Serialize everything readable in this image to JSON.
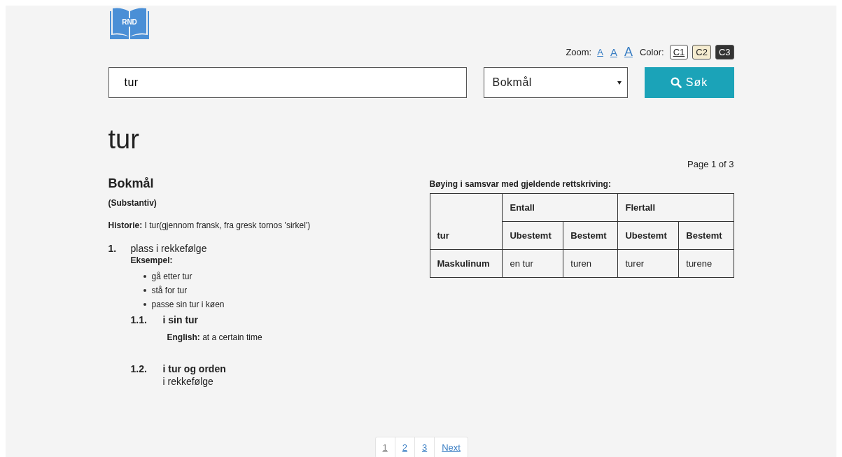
{
  "logo": {
    "text": "RND"
  },
  "zoom": {
    "label": "Zoom:",
    "sizes": [
      {
        "label": "A",
        "kind": "small"
      },
      {
        "label": "A",
        "kind": "medium"
      },
      {
        "label": "A",
        "kind": "large"
      }
    ]
  },
  "color": {
    "label": "Color:",
    "options": [
      {
        "label": "C1",
        "color": "#ffffff",
        "selected": true
      },
      {
        "label": "C2",
        "color": "#f5ecd0",
        "selected": false
      },
      {
        "label": "C3",
        "color": "#333333",
        "selected": false
      }
    ]
  },
  "search": {
    "value": "tur",
    "language": "Bokmål",
    "button": "Søk"
  },
  "headword": "tur",
  "page_info": "Page 1 of 3",
  "entry": {
    "language": "Bokmål",
    "word_class": "(Substantiv)",
    "history": "**Historie:** I tur(gjennom fransk, fra gresk tornos 'sirkel')",
    "senses": [
      {
        "number": "1.",
        "definition": "plass i rekkefølge",
        "examples_label": "Eksempel:",
        "examples": [
          "gå etter tur",
          "stå for tur",
          "passe sin tur i køen"
        ],
        "subsenses": [
          {
            "number": "1.1.",
            "phrase": "i sin tur",
            "gloss": "**English:** at a certain time"
          },
          {
            "number": "1.2.",
            "phrase": "i tur og orden",
            "gloss": "i rekkefølge"
          }
        ]
      }
    ]
  },
  "inflection": {
    "title": "Bøying i samsvar med gjeldende rettskriving:",
    "word": "tur",
    "groups": [
      "Entall",
      "Flertall"
    ],
    "columns": [
      "Ubestemt",
      "Bestemt",
      "Ubestemt",
      "Bestemt"
    ],
    "rows": [
      {
        "label": "Maskulinum",
        "cells": [
          "en tur",
          "turen",
          "turer",
          "turene"
        ]
      }
    ]
  },
  "pagination": [
    {
      "label": "1",
      "selected": true
    },
    {
      "label": "2",
      "selected": false
    },
    {
      "label": "3",
      "selected": false
    },
    {
      "label": "Next",
      "selected": false
    }
  ]
}
